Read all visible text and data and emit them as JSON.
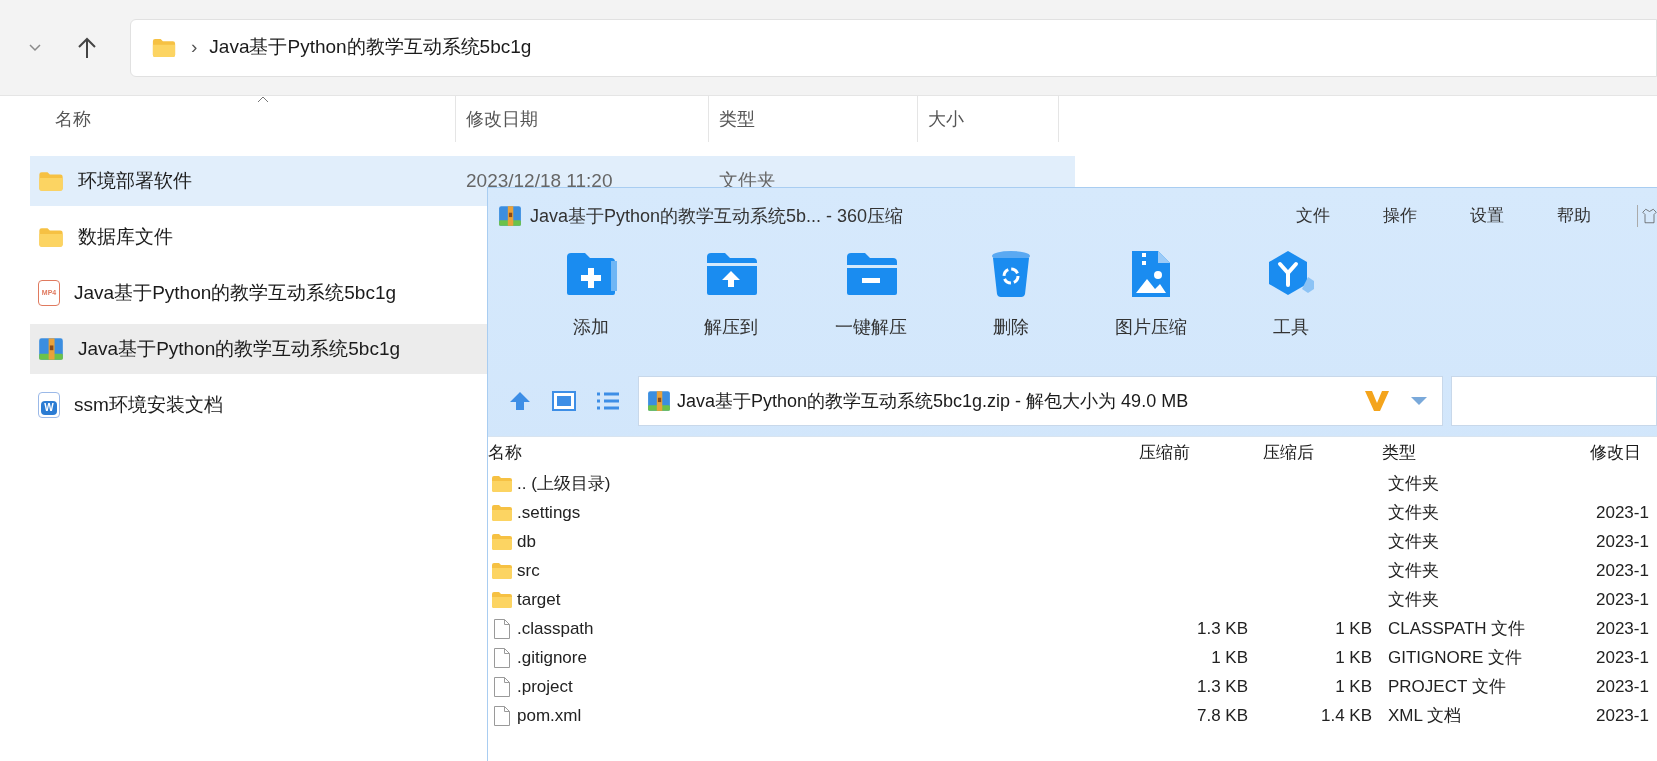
{
  "explorer": {
    "path": {
      "separator": "›",
      "text": "Java基于Python的教学互动系统5bc1g"
    },
    "columns": [
      "名称",
      "修改日期",
      "类型",
      "大小"
    ],
    "rows": [
      {
        "kind": "folder",
        "name": "环境部署软件",
        "date": "2023/12/18 11:20",
        "type": "文件夹",
        "selected": true,
        "hovered": false
      },
      {
        "kind": "folder",
        "name": "数据库文件",
        "selected": false,
        "hovered": false
      },
      {
        "kind": "video",
        "name": "Java基于Python的教学互动系统5bc1g",
        "badge": "MP4",
        "selected": false,
        "hovered": false
      },
      {
        "kind": "archive",
        "name": "Java基于Python的教学互动系统5bc1g",
        "selected": false,
        "hovered": true
      },
      {
        "kind": "word",
        "name": "ssm环境安装文档",
        "badge": "W",
        "selected": false,
        "hovered": false
      }
    ]
  },
  "archiver": {
    "title": "Java基于Python的教学互动系统5b... - 360压缩",
    "menu": [
      "文件",
      "操作",
      "设置",
      "帮助"
    ],
    "tools": [
      {
        "kind": "add",
        "label": "添加"
      },
      {
        "kind": "extract",
        "label": "解压到"
      },
      {
        "kind": "oneclick",
        "label": "一键解压"
      },
      {
        "kind": "delete",
        "label": "删除"
      },
      {
        "kind": "image",
        "label": "图片压缩"
      },
      {
        "kind": "tools",
        "label": "工具"
      }
    ],
    "path": "Java基于Python的教学互动系统5bc1g.zip - 解包大小为 49.0 MB",
    "columns": [
      "名称",
      "压缩前",
      "压缩后",
      "类型",
      "修改日"
    ],
    "rows": [
      {
        "kind": "folder",
        "name": ".. (上级目录)",
        "type": "文件夹"
      },
      {
        "kind": "folder",
        "name": ".settings",
        "type": "文件夹",
        "date": "2023-1"
      },
      {
        "kind": "folder",
        "name": "db",
        "type": "文件夹",
        "date": "2023-1"
      },
      {
        "kind": "folder",
        "name": "src",
        "type": "文件夹",
        "date": "2023-1"
      },
      {
        "kind": "folder",
        "name": "target",
        "type": "文件夹",
        "date": "2023-1"
      },
      {
        "kind": "file",
        "name": ".classpath",
        "before": "1.3 KB",
        "after": "1 KB",
        "type": "CLASSPATH 文件",
        "date": "2023-1"
      },
      {
        "kind": "file",
        "name": ".gitignore",
        "before": "1 KB",
        "after": "1 KB",
        "type": "GITIGNORE 文件",
        "date": "2023-1"
      },
      {
        "kind": "file",
        "name": ".project",
        "before": "1.3 KB",
        "after": "1 KB",
        "type": "PROJECT 文件",
        "date": "2023-1"
      },
      {
        "kind": "file",
        "name": "pom.xml",
        "before": "7.8 KB",
        "after": "1.4 KB",
        "type": "XML 文档",
        "date": "2023-1"
      }
    ]
  }
}
